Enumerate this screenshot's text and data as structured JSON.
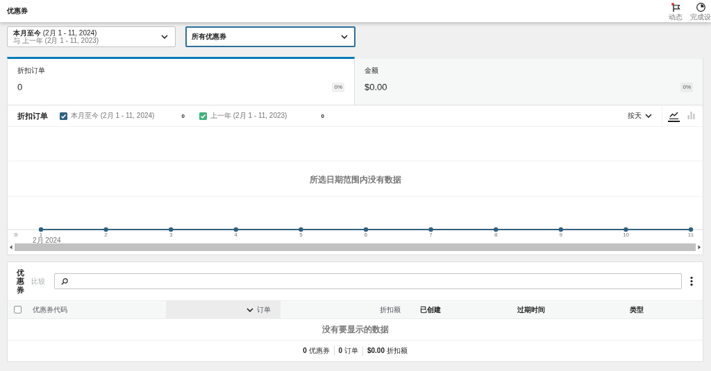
{
  "header": {
    "title": "优惠券",
    "actions": [
      {
        "kind": "flag",
        "label": "动态",
        "alert": true
      },
      {
        "kind": "progress",
        "label": "完成设"
      }
    ]
  },
  "filters": {
    "date_range": {
      "current": "**本月至今** (2月 1 - 11, 2024)",
      "compare": "与 上一年 (2月 1 - 11, 2023)"
    },
    "coupon_filter": {
      "value": "所有优惠券",
      "focused": true
    }
  },
  "summary": [
    {
      "label": "折扣订单",
      "value": "0",
      "change": "0%",
      "selected": true
    },
    {
      "label": "金额",
      "value": "$0.00",
      "change": "0%",
      "selected": false
    }
  ],
  "chart": {
    "title": "折扣订单",
    "legend": [
      {
        "label": "本月至今 (2月 1 - 11, 2024)",
        "value": "0",
        "checked": true,
        "color": "#30607f"
      },
      {
        "label": "上一年 (2月 1 - 11, 2023)",
        "value": "0",
        "checked": true,
        "color": "#3fb37a"
      }
    ],
    "interval": "按天",
    "chart_types": [
      {
        "kind": "line",
        "selected": true
      },
      {
        "kind": "bar",
        "selected": false
      }
    ],
    "empty_message": "所选日期范围内没有数据",
    "y_tick": "0",
    "x_labels": [
      "1",
      "2",
      "3",
      "4",
      "5",
      "6",
      "7",
      "8",
      "9",
      "10",
      "11"
    ],
    "month_label": "2月 2024"
  },
  "table": {
    "title": "优惠券",
    "compare_label": "比较",
    "select_all": {
      "checked": false
    },
    "columns": [
      {
        "label": "优惠券代码",
        "sortable": true,
        "numeric": false,
        "sorted": false
      },
      {
        "label": "订单",
        "sortable": true,
        "numeric": true,
        "sorted": true
      },
      {
        "label": "折扣额",
        "sortable": true,
        "numeric": true,
        "sorted": false
      },
      {
        "label": "已创建",
        "sortable": false,
        "numeric": false,
        "sorted": false
      },
      {
        "label": "过期时间",
        "sortable": false,
        "numeric": false,
        "sorted": false
      },
      {
        "label": "类型",
        "sortable": false,
        "numeric": false,
        "sorted": false
      }
    ],
    "empty_message": "没有要显示的数据",
    "totals": [
      "**0** 优惠券",
      "**0** 订单",
      "**$0.00** 折扣额"
    ]
  }
}
